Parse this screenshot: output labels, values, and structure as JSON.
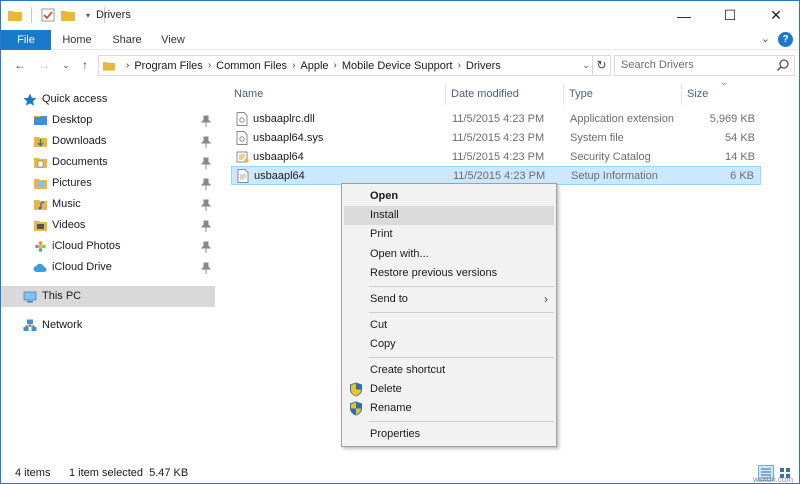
{
  "window": {
    "title": "Drivers"
  },
  "ribbon": {
    "tabs": [
      {
        "label": "File"
      },
      {
        "label": "Home"
      },
      {
        "label": "Share"
      },
      {
        "label": "View"
      }
    ]
  },
  "address": {
    "segments": [
      "Program Files",
      "Common Files",
      "Apple",
      "Mobile Device Support",
      "Drivers"
    ]
  },
  "search": {
    "placeholder": "Search Drivers"
  },
  "nav": {
    "quick_access": "Quick access",
    "items": [
      {
        "label": "Desktop",
        "icon": "desktop-icon"
      },
      {
        "label": "Downloads",
        "icon": "downloads-icon"
      },
      {
        "label": "Documents",
        "icon": "documents-icon"
      },
      {
        "label": "Pictures",
        "icon": "pictures-icon"
      },
      {
        "label": "Music",
        "icon": "music-icon"
      },
      {
        "label": "Videos",
        "icon": "videos-icon"
      },
      {
        "label": "iCloud Photos",
        "icon": "icloud-photos-icon"
      },
      {
        "label": "iCloud Drive",
        "icon": "icloud-drive-icon"
      }
    ],
    "this_pc": "This PC",
    "network": "Network"
  },
  "columns": {
    "name": "Name",
    "date": "Date modified",
    "type": "Type",
    "size": "Size"
  },
  "files": [
    {
      "name": "usbaaplrc.dll",
      "date": "11/5/2015 4:23 PM",
      "type": "Application extension",
      "size": "5,969 KB",
      "icon": "dll-file-icon"
    },
    {
      "name": "usbaapl64.sys",
      "date": "11/5/2015 4:23 PM",
      "type": "System file",
      "size": "54 KB",
      "icon": "sys-file-icon"
    },
    {
      "name": "usbaapl64",
      "date": "11/5/2015 4:23 PM",
      "type": "Security Catalog",
      "size": "14 KB",
      "icon": "catalog-file-icon"
    },
    {
      "name": "usbaapl64",
      "date": "11/5/2015 4:23 PM",
      "type": "Setup Information",
      "size": "6 KB",
      "icon": "inf-file-icon"
    }
  ],
  "context_menu": {
    "open": "Open",
    "install": "Install",
    "print": "Print",
    "open_with": "Open with...",
    "restore": "Restore previous versions",
    "send_to": "Send to",
    "cut": "Cut",
    "copy": "Copy",
    "create_shortcut": "Create shortcut",
    "delete": "Delete",
    "rename": "Rename",
    "properties": "Properties"
  },
  "status": {
    "items": "4 items",
    "selected": "1 item selected  5.47 KB"
  },
  "watermark": "wsxdn.com",
  "colors": {
    "accent": "#1979ca",
    "selection": "#cce8ff",
    "folder": "#e8b73f"
  }
}
